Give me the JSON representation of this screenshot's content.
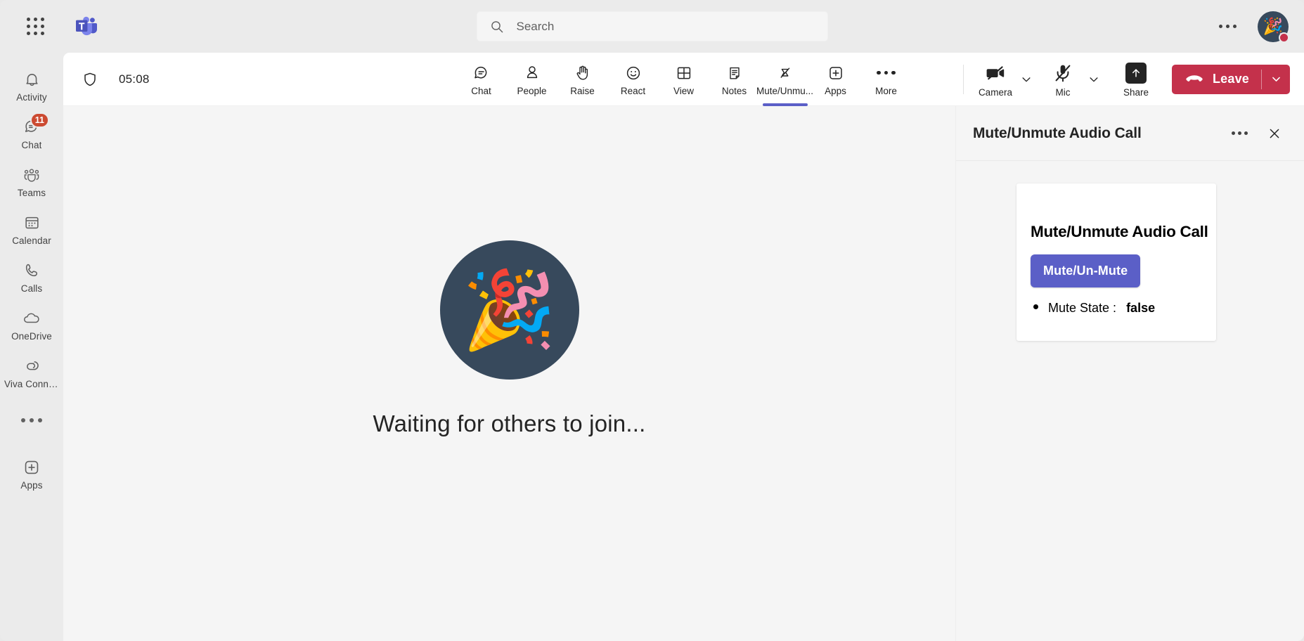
{
  "topbar": {
    "waffle_label": "app-launcher",
    "logo_label": "Microsoft Teams",
    "search": {
      "placeholder": "Search",
      "value": "",
      "icon": "search-icon"
    },
    "more_label": "...",
    "avatar": {
      "emoji": "🎉",
      "presence": "busy",
      "presence_color": "#C4314B"
    }
  },
  "sidebar": {
    "items": [
      {
        "label": "Activity",
        "icon": "bell-icon",
        "badge": ""
      },
      {
        "label": "Chat",
        "icon": "chat-icon",
        "badge": "11"
      },
      {
        "label": "Teams",
        "icon": "teams-icon",
        "badge": ""
      },
      {
        "label": "Calendar",
        "icon": "calendar-icon",
        "badge": ""
      },
      {
        "label": "Calls",
        "icon": "phone-icon",
        "badge": ""
      },
      {
        "label": "OneDrive",
        "icon": "cloud-icon",
        "badge": ""
      },
      {
        "label": "Viva Conne...",
        "icon": "viva-connections-icon",
        "badge": ""
      }
    ],
    "more_label": "...",
    "apps": {
      "label": "Apps",
      "icon": "plus-box-icon"
    },
    "badge_color": "#CC4A31"
  },
  "meeting": {
    "shield_icon": "shield-icon",
    "timer": "05:08",
    "tools": [
      {
        "label": "Chat",
        "icon": "chat-bubble-icon",
        "active": false
      },
      {
        "label": "People",
        "icon": "person-icon",
        "active": false
      },
      {
        "label": "Raise",
        "icon": "raise-hand-icon",
        "active": false
      },
      {
        "label": "React",
        "icon": "smiley-icon",
        "active": false
      },
      {
        "label": "View",
        "icon": "grid-view-icon",
        "active": false
      },
      {
        "label": "Notes",
        "icon": "notes-icon",
        "active": false
      },
      {
        "label": "Mute/Unmu...",
        "icon": "mute-unmute-app-icon",
        "active": true
      },
      {
        "label": "Apps",
        "icon": "plus-box-icon",
        "active": false
      },
      {
        "label": "More",
        "icon": "more-ellipsis-icon",
        "active": false
      }
    ],
    "camera": {
      "label": "Camera",
      "icon": "camera-off-icon",
      "state": "off"
    },
    "mic": {
      "label": "Mic",
      "icon": "mic-off-icon",
      "state": "muted"
    },
    "share": {
      "label": "Share",
      "icon": "share-up-arrow-icon"
    },
    "leave": {
      "label": "Leave",
      "icon": "hang-up-icon",
      "color": "#C4314B"
    },
    "active_tab_color": "#5B5FC7"
  },
  "stage": {
    "emoji": "🎉",
    "circle_color": "#37495C",
    "waiting_text": "Waiting for others to join..."
  },
  "panel": {
    "title": "Mute/Unmute Audio Call",
    "more_label": "...",
    "close_label": "Close",
    "card": {
      "title": "Mute/Unmute Audio Call",
      "button_label": "Mute/Un-Mute",
      "button_color": "#5B5FC7",
      "items": [
        {
          "label": "Mute State :",
          "value": "false"
        }
      ]
    }
  }
}
